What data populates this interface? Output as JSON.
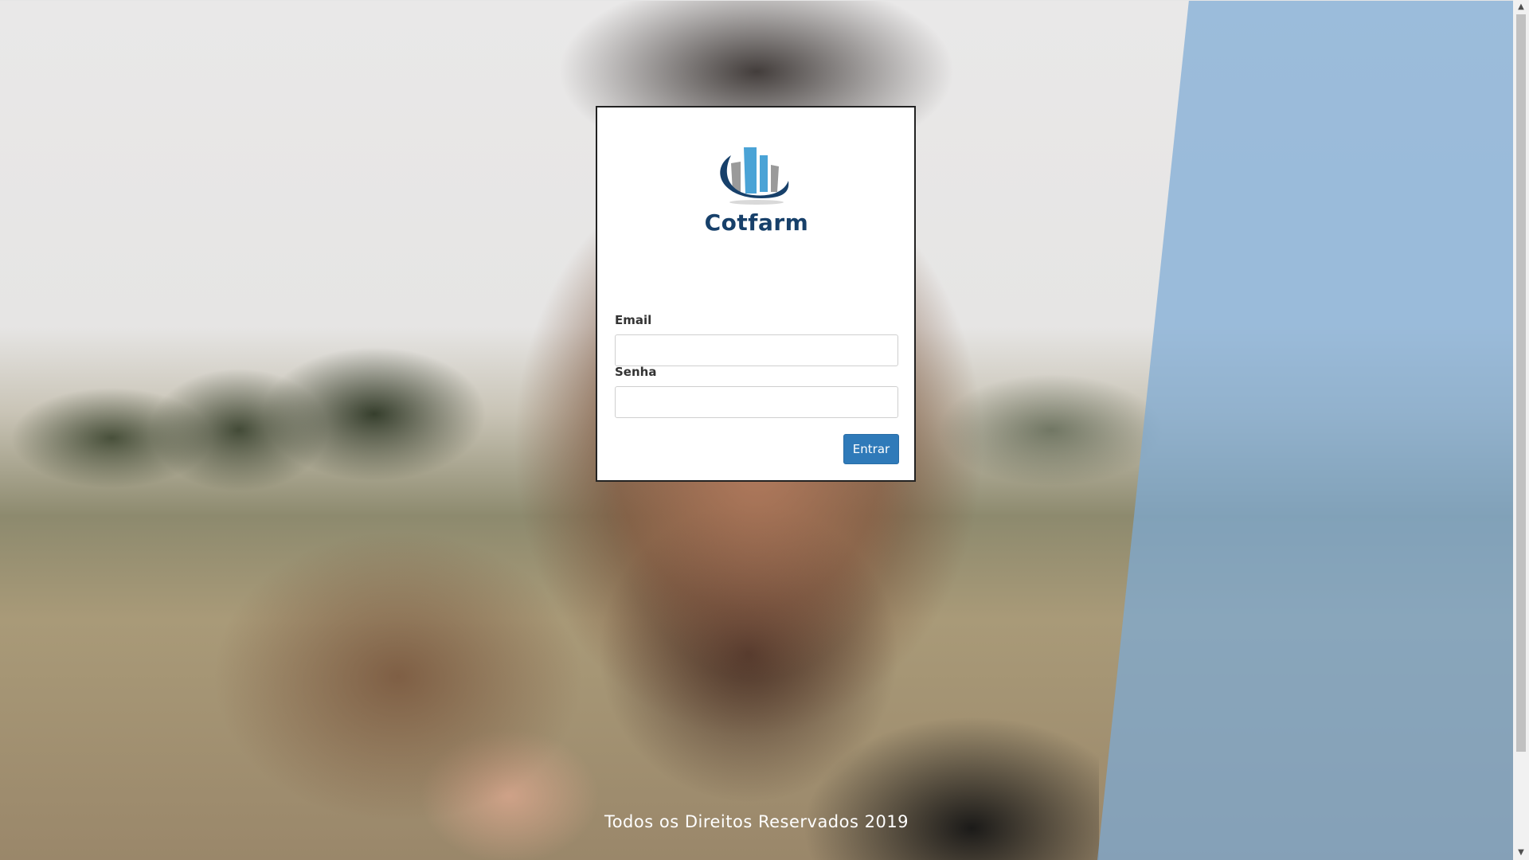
{
  "brand": {
    "name": "Cotfarm",
    "logo_icon": "bar-chart-swoosh-icon",
    "colors": {
      "dark_blue": "#17406a",
      "light_blue": "#4aa3d6",
      "gray": "#9a9a9a"
    }
  },
  "login": {
    "email_label": "Email",
    "email_value": "",
    "password_label": "Senha",
    "password_value": "",
    "submit_label": "Entrar",
    "button_color": "#2f7ab9"
  },
  "footer": {
    "text": "Todos os Direitos Reservados 2019"
  },
  "scrollbar": {
    "up_icon": "scroll-up-arrow-icon",
    "down_icon": "scroll-down-arrow-icon"
  }
}
